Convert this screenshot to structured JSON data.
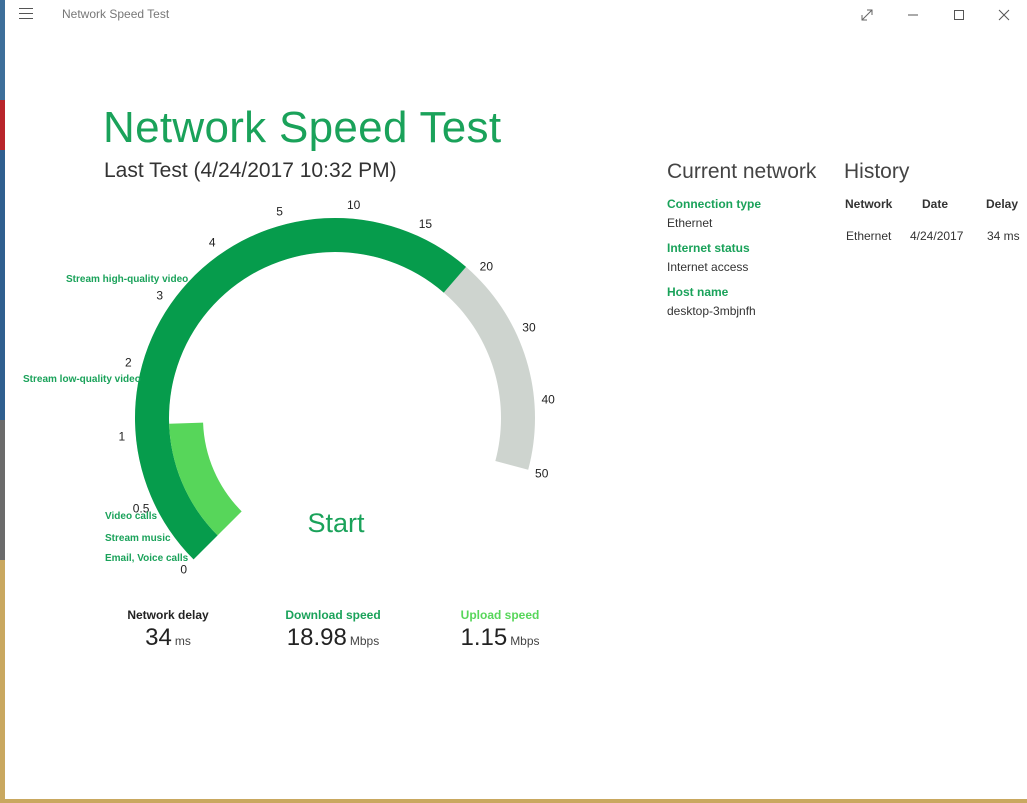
{
  "window": {
    "app_title": "Network Speed Test"
  },
  "header": {
    "title": "Network Speed Test",
    "last_test": "Last Test (4/24/2017 10:32 PM)"
  },
  "gauge": {
    "scale_labels": [
      "0",
      "0.5",
      "1",
      "2",
      "3",
      "4",
      "5",
      "10",
      "15",
      "20",
      "30",
      "40",
      "50"
    ],
    "download_mbps": 18.98,
    "upload_mbps": 1.15,
    "activity_labels": {
      "hq_video": "Stream high-quality video",
      "lq_video": "Stream low-quality video",
      "video_calls": "Video calls",
      "music": "Stream music",
      "email_voice": "Email, Voice calls"
    },
    "start_label": "Start",
    "colors": {
      "download": "#069c4c",
      "upload": "#57d65a",
      "track": "#ced4cf"
    }
  },
  "stats": {
    "delay": {
      "label": "Network delay",
      "value": "34",
      "unit": "ms"
    },
    "download": {
      "label": "Download speed",
      "value": "18.98",
      "unit": "Mbps"
    },
    "upload": {
      "label": "Upload speed",
      "value": "1.15",
      "unit": "Mbps"
    }
  },
  "current_network": {
    "title": "Current network",
    "connection_type_label": "Connection type",
    "connection_type": "Ethernet",
    "internet_status_label": "Internet status",
    "internet_status": "Internet access",
    "host_name_label": "Host name",
    "host_name": "desktop-3mbjnfh"
  },
  "history": {
    "title": "History",
    "columns": [
      "Network",
      "Date",
      "Delay"
    ],
    "rows": [
      [
        "Ethernet",
        "4/24/2017",
        "34 ms"
      ]
    ]
  },
  "icons": {
    "menu": "hamburger-icon",
    "fullscreen": "expand-icon",
    "minimize": "minimize-icon",
    "maximize": "maximize-icon",
    "close": "close-icon"
  }
}
